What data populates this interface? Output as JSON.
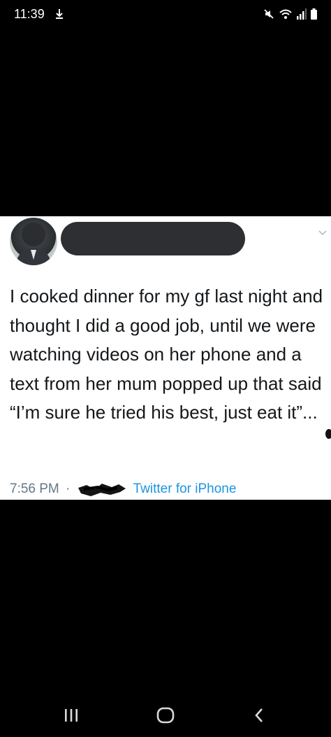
{
  "status_bar": {
    "time": "11:39",
    "left_icon": "download-notification-icon",
    "right_icons": [
      "mute-icon",
      "wifi-icon",
      "signal-icon",
      "battery-icon"
    ]
  },
  "tweet": {
    "text": "I cooked dinner for my gf last night and thought I did a good job, until we were watching videos on her phone and a text from her mum popped up that said “I’m sure he tried his best, just eat it”...",
    "time": "7:56 PM",
    "separator": "·",
    "source": "Twitter for iPhone",
    "colors": {
      "text": "#14171a",
      "meta": "#657786",
      "link": "#1b95e0"
    }
  },
  "nav_bar": {
    "buttons": [
      "recent-apps-icon",
      "home-icon",
      "back-icon"
    ]
  }
}
